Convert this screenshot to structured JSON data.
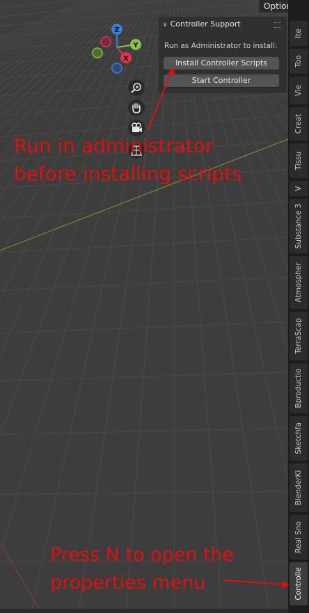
{
  "header": {
    "options_label": "Options"
  },
  "panel": {
    "title": "Controller Support",
    "instruction": "Run as Administrator to install:",
    "install_button": "Install Controller Scripts",
    "start_button": "Start Controller"
  },
  "gizmo": {
    "z_label": "Z",
    "y_label": "Y",
    "x_label": "X"
  },
  "sidebar_tabs": [
    "Ite",
    "Too",
    "Vie",
    "Creat",
    "Tissu",
    "V",
    "Substance 3",
    "Atmospher",
    "TerraScap",
    "Bproductio",
    "Sketchfa",
    "BlenderKi",
    "Real Sno",
    "Controlle"
  ],
  "annotations": {
    "note1_line1": "Run in administrator",
    "note1_line2": "before installing scripts",
    "note2_line1": "Press N to open the",
    "note2_line2": "properties menu"
  },
  "colors": {
    "annotation": "#e01010",
    "x_axis": "#e3334f",
    "y_axis": "#8bc04a",
    "z_axis": "#3a7fd6"
  }
}
